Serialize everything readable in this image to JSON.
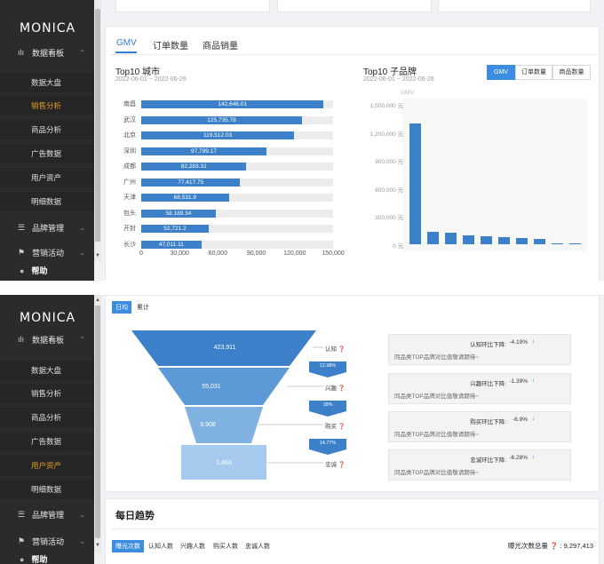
{
  "app": {
    "logo": "MONICA"
  },
  "top": {
    "sidebar": {
      "group": {
        "label": "数据看板",
        "icon": "bar-chart-icon"
      },
      "items": [
        {
          "label": "数据大盘"
        },
        {
          "label": "销售分析"
        },
        {
          "label": "商品分析"
        },
        {
          "label": "广告数据"
        },
        {
          "label": "用户资产"
        },
        {
          "label": "明细数据"
        }
      ],
      "brand": {
        "label": "品牌管理",
        "icon": "list-icon"
      },
      "marketing": {
        "label": "营销活动",
        "icon": "flag-icon"
      },
      "help": {
        "label": "帮助"
      },
      "active_index": 1
    },
    "tabs": [
      "GMV",
      "订单数量",
      "商品销量"
    ],
    "left_chart_title": "Top10 城市",
    "left_chart_date": "2022-06-01 ~ 2022-06-26",
    "right_chart_title": "Top10 子品牌",
    "right_chart_date": "2022-06-01 ~ 2022-06-26",
    "metric_buttons": [
      "GMV",
      "订单数量",
      "商品数量"
    ],
    "right_axis_title": "GMV"
  },
  "chart_data": [
    {
      "type": "bar",
      "orientation": "horizontal",
      "title": "Top10 城市",
      "categories": [
        "南昌",
        "武汉",
        "北京",
        "深圳",
        "成都",
        "广州",
        "天津",
        "包头",
        "开封",
        "长沙"
      ],
      "values": [
        142646.01,
        125735.78,
        119512.03,
        97799.17,
        82283.31,
        77417.75,
        68531.9,
        58189.34,
        52721.2,
        47011.11
      ],
      "value_labels": [
        "142,646.01",
        "125,735.78",
        "119,512.03",
        "97,799.17",
        "82,283.31",
        "77,417.75",
        "68,531.9",
        "58,189.34",
        "52,721.2",
        "47,011.11"
      ],
      "xlim": [
        0,
        150000
      ],
      "xticks": [
        "0",
        "30,000",
        "60,000",
        "90,000",
        "120,000",
        "150,000"
      ],
      "color": "#3b80c8"
    },
    {
      "type": "bar",
      "title": "Top10 子品牌",
      "ylabel": "GMV",
      "ylim": [
        0,
        1500000
      ],
      "yticks": [
        "0 元",
        "300,000 元",
        "600,000 元",
        "900,000 元",
        "1,200,000 元",
        "1,500,000 元"
      ],
      "values": [
        1290000,
        130000,
        120000,
        95000,
        85000,
        75000,
        65000,
        55000,
        10000,
        5000
      ],
      "color": "#3b80c8"
    }
  ],
  "bottom": {
    "toggle": [
      "日均",
      "累计"
    ],
    "funnel": {
      "values": [
        "423,911",
        "55,031",
        "9,908",
        "1,463"
      ],
      "stages": [
        "认知",
        "兴趣",
        "购买",
        "忠诚"
      ],
      "conversions": [
        "12.98%",
        "18%",
        "14.77%"
      ],
      "colors": [
        "#3b80c8",
        "#5b9ad6",
        "#7fb2e1",
        "#a7cbef"
      ]
    },
    "insights": [
      {
        "head": "认知环比下降:",
        "value": "-4.19%",
        "desc": "同品类TOP品牌对比值敬请期待~"
      },
      {
        "head": "兴趣环比下降:",
        "value": "-1.39%",
        "desc": "同品类TOP品牌对比值敬请期待~"
      },
      {
        "head": "购买环比下降:",
        "value": "-6.9%",
        "desc": "同品类TOP品牌对比值敬请期待~"
      },
      {
        "head": "忠诚环比下降:",
        "value": "-6.28%",
        "desc": "同品类TOP品牌对比值敬请期待~"
      }
    ],
    "daily_trend_title": "每日趋势",
    "trend_tabs": [
      "曝光次数",
      "认知人数",
      "兴趣人数",
      "购买人数",
      "忠诚人数"
    ],
    "total_label": "曝光次数总量",
    "total_value": "9,297,413"
  }
}
